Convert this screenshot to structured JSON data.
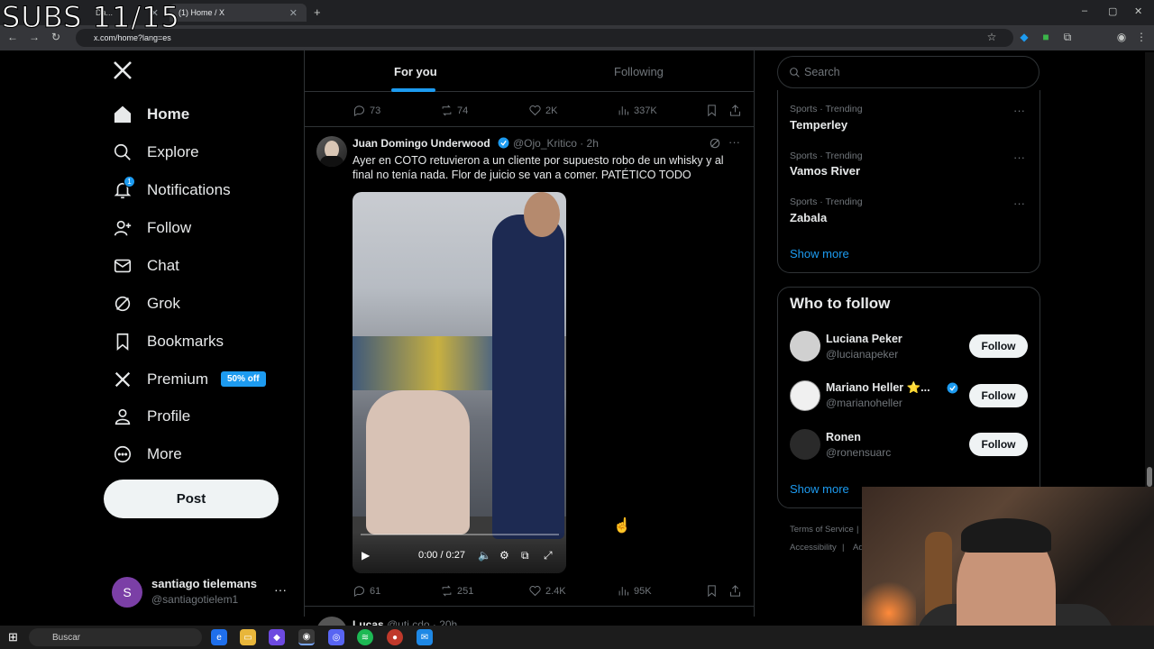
{
  "overlay": {
    "text": "SUBS 11/15"
  },
  "browser": {
    "tabs": [
      {
        "label": "Da..."
      },
      {
        "label": "(1) Home / X"
      }
    ],
    "new_tab": "+",
    "url": "x.com/home?lang=es",
    "window_controls": {
      "minimize": "–",
      "maximize": "▢",
      "close": "✕"
    }
  },
  "nav": {
    "logo": "X",
    "items": [
      {
        "label": "Home",
        "icon": "home-icon"
      },
      {
        "label": "Explore",
        "icon": "search-icon"
      },
      {
        "label": "Notifications",
        "icon": "bell-icon"
      },
      {
        "label": "Follow",
        "icon": "person-plus-icon"
      },
      {
        "label": "Chat",
        "icon": "mail-icon"
      },
      {
        "label": "Grok",
        "icon": "grok-icon"
      },
      {
        "label": "Bookmarks",
        "icon": "bookmark-icon"
      },
      {
        "label": "Premium",
        "icon": "x-icon"
      },
      {
        "label": "Profile",
        "icon": "person-icon"
      },
      {
        "label": "More",
        "icon": "more-circle-icon"
      }
    ],
    "notification_count": "1",
    "premium_badge": "50% off",
    "post_label": "Post",
    "account": {
      "initial": "S",
      "name": "santiago tielemans",
      "handle": "@santiagotielem1",
      "more": "···"
    }
  },
  "feed": {
    "tabs": [
      {
        "label": "For you"
      },
      {
        "label": "Following"
      }
    ],
    "prev_tweet_actions": {
      "replies": "73",
      "reposts": "74",
      "likes": "2K",
      "views": "337K"
    },
    "tweet": {
      "name": "Juan Domingo Underwood",
      "handle": "@Ojo_Kritico",
      "time": "· 2h",
      "text": "Ayer en COTO retuvieron a un cliente por supuesto robo de un whisky y al final no tenía nada. Flor de juicio se van a comer. PATÉTICO TODO",
      "video_time": "0:00 / 0:27",
      "actions": {
        "replies": "61",
        "reposts": "251",
        "likes": "2.4K",
        "views": "95K"
      },
      "more": "···"
    },
    "next_tweet": {
      "name": "Lucas",
      "handle": "@uti.cdo · 20h"
    }
  },
  "right": {
    "search_placeholder": "Search",
    "trends": [
      {
        "category": "Sports · Trending",
        "name": "Temperley"
      },
      {
        "category": "Sports · Trending",
        "name": "Vamos River"
      },
      {
        "category": "Sports · Trending",
        "name": "Zabala"
      }
    ],
    "trends_more": "···",
    "show_more": "Show more",
    "who_to_follow_title": "Who to follow",
    "who_to_follow": [
      {
        "name": "Luciana Peker",
        "handle": "@lucianapeker",
        "button": "Follow"
      },
      {
        "name": "Mariano Heller ⭐...",
        "handle": "@marianoheller",
        "button": "Follow"
      },
      {
        "name": "Ronen",
        "handle": "@ronensuarc",
        "button": "Follow"
      }
    ],
    "wtf_show_more": "Show more",
    "footer": {
      "terms": "Terms of Service",
      "accessibility": "Accessibility",
      "sep": "|",
      "ads": "Ad"
    }
  },
  "taskbar": {
    "search_placeholder": "Buscar"
  },
  "colors": {
    "accent": "#1d9bf0",
    "background": "#000000",
    "text": "#e7e9ea",
    "muted": "#71767b"
  }
}
